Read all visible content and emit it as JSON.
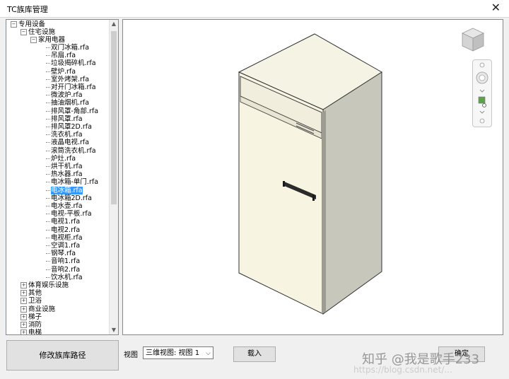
{
  "window": {
    "title": "TC族库管理",
    "close_glyph": "✕"
  },
  "tree": {
    "root": "专用设备",
    "group": "住宅设施",
    "subgroup": "家用电器",
    "files": [
      "双门冰箱.rfa",
      "吊扇.rfa",
      "垃圾揭碎机.rfa",
      "壁炉.rfa",
      "室外烤架.rfa",
      "对开门冰箱.rfa",
      "微波炉.rfa",
      "抽油烟机.rfa",
      "排风罩-角部.rfa",
      "排风罩.rfa",
      "排风罩2D.rfa",
      "洗衣机.rfa",
      "液晶电视.rfa",
      "滚筒洗衣机.rfa",
      "炉灶.rfa",
      "烘干机.rfa",
      "热水器.rfa",
      "电冰箱-单门.rfa",
      "电冰箱.rfa",
      "电冰箱2D.rfa",
      "电水壶.rfa",
      "电视-平板.rfa",
      "电视1.rfa",
      "电视2.rfa",
      "电视柜.rfa",
      "空调1.rfa",
      "钢琴.rfa",
      "音响1.rfa",
      "音响2.rfa",
      "饮水机.rfa"
    ],
    "selected_file": "电冰箱.rfa",
    "categories": [
      "体育娱乐设施",
      "其他",
      "卫浴",
      "商业设施",
      "梯子",
      "消防",
      "电梯"
    ]
  },
  "bottom": {
    "path_button": "修改族库路径",
    "view_label": "视图",
    "view_value": "三维视图: 视图 1",
    "load_button": "载入",
    "ok_button": "确定"
  },
  "watermark": {
    "main": "知乎 @我是歌手233",
    "sub": "https://blog.csdn.net/..."
  },
  "colors": {
    "selection": "#3399ff",
    "fridge_front": "#f7f4e2",
    "fridge_side": "#c9c8bc"
  }
}
